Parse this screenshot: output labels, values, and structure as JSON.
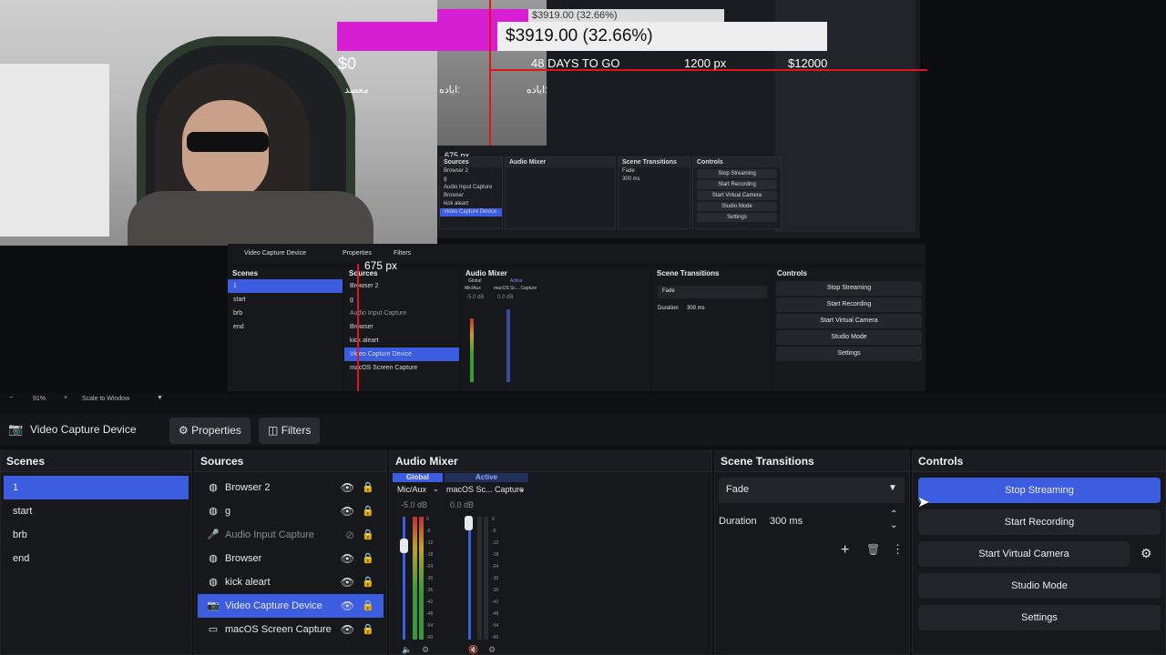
{
  "overlay": {
    "goal_amount": "$3919.00 (32.66%)",
    "goal_amount_ghost": "$3919.00 (32.66%)",
    "start_value": "$0",
    "days_to_go": "48 DAYS TO GO",
    "px_label_top": "1200 px",
    "end_value": "$12000",
    "rtl_label_1": "معصد",
    "rtl_label_2": "ايادە:",
    "rtl_label_3": "ايادە:",
    "px_label_small": "675 px",
    "px_label_mid": "675 px",
    "colors": {
      "accent": "#3d5de0",
      "goal_bar": "#d61ed3",
      "guide": "#e0151b"
    }
  },
  "mini_obs": {
    "sources": [
      "Browser 2",
      "g",
      "Audio Input Capture",
      "Browser",
      "kick aleart",
      "Video Capture Device",
      "macOS Screen Capture"
    ],
    "transition": "Fade",
    "duration": "300 ms",
    "controls": [
      "Stop Streaming",
      "Start Recording",
      "Start Virtual Camera",
      "Studio Mode",
      "Settings"
    ]
  },
  "mid_obs": {
    "source_title": "Video Capture Device",
    "properties": "Properties",
    "filters": "Filters",
    "scenes_title": "Scenes",
    "scenes": [
      "1",
      "start",
      "brb",
      "end"
    ],
    "sources_title": "Sources",
    "sources": [
      "Browser 2",
      "g",
      "Audio Input Capture",
      "Browser",
      "kick aleart",
      "Video Capture Device",
      "macOS Screen Capture"
    ],
    "mixer_title": "Audio Mixer",
    "mixer_tabs": [
      "Global",
      "Active"
    ],
    "channels": [
      {
        "name": "Mic/Aux",
        "db": "-5.0 dB"
      },
      {
        "name": "macOS Sc... Capture",
        "db": "0.0 dB"
      }
    ],
    "transitions_title": "Scene Transitions",
    "transition": "Fade",
    "duration_label": "Duration",
    "duration": "300 ms",
    "controls_title": "Controls",
    "controls": [
      "Stop Streaming",
      "Start Recording",
      "Start Virtual Camera",
      "Studio Mode",
      "Settings"
    ]
  },
  "zoom": {
    "minus": "−",
    "value": "91%",
    "plus": "+",
    "mode": "Scale to Window"
  },
  "obs": {
    "source_title": "Video Capture Device",
    "properties_label": "Properties",
    "filters_label": "Filters",
    "scenes": {
      "title": "Scenes",
      "items": [
        "1",
        "start",
        "brb",
        "end"
      ],
      "selected": 0
    },
    "sources": {
      "title": "Sources",
      "items": [
        {
          "label": "Browser 2",
          "icon": "globe-icon",
          "visible": true
        },
        {
          "label": "g",
          "icon": "globe-icon",
          "visible": true
        },
        {
          "label": "Audio Input Capture",
          "icon": "microphone-icon",
          "visible": false
        },
        {
          "label": "Browser",
          "icon": "globe-icon",
          "visible": true
        },
        {
          "label": "kick aleart",
          "icon": "globe-icon",
          "visible": true
        },
        {
          "label": "Video Capture Device",
          "icon": "camera-icon",
          "visible": true
        },
        {
          "label": "macOS Screen Capture",
          "icon": "monitor-icon",
          "visible": true
        }
      ],
      "selected": 5
    },
    "mixer": {
      "title": "Audio Mixer",
      "tab_global": "Global",
      "tab_active": "Active",
      "ch1_name": "Mic/Aux",
      "ch1_db": "-5.0 dB",
      "ch2_name": "macOS Sc... Capture",
      "ch2_db": "0.0 dB",
      "ticks": [
        "0",
        "-6",
        "-12",
        "-18",
        "-24",
        "-30",
        "-36",
        "-42",
        "-48",
        "-54",
        "-60"
      ]
    },
    "transitions": {
      "title": "Scene Transitions",
      "selected": "Fade",
      "duration_label": "Duration",
      "duration": "300 ms"
    },
    "controls": {
      "title": "Controls",
      "stop_streaming": "Stop Streaming",
      "start_recording": "Start Recording",
      "start_virtual_camera": "Start Virtual Camera",
      "studio_mode": "Studio Mode",
      "settings": "Settings"
    }
  }
}
